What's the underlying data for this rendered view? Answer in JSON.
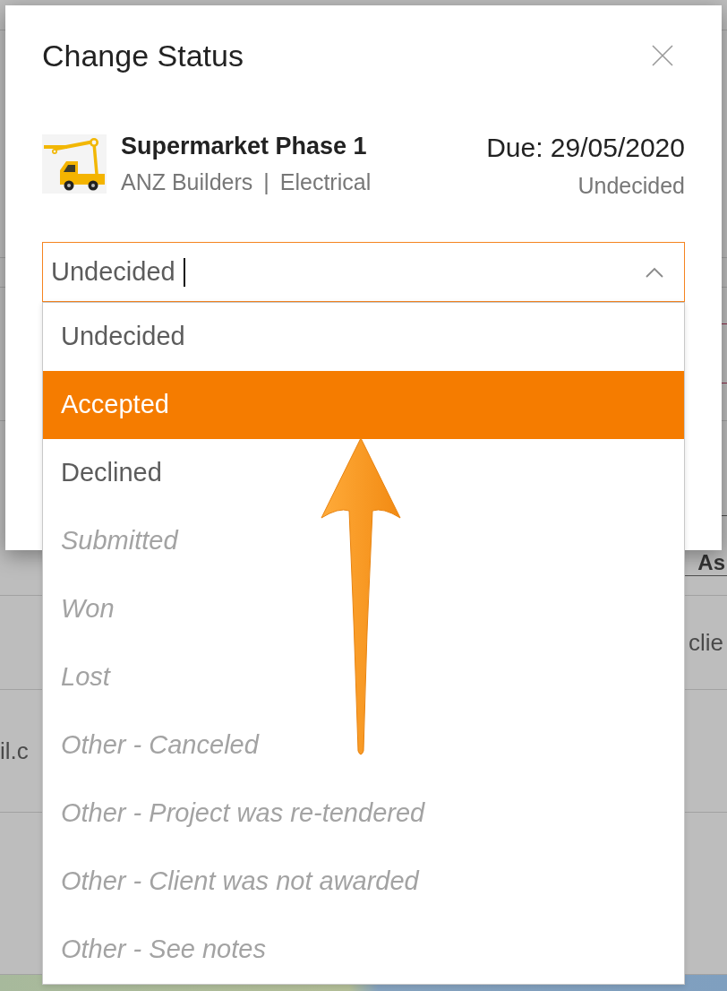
{
  "background": {
    "column_heading": "As",
    "cell_right": "clie",
    "cell_left": "il.c"
  },
  "modal": {
    "title": "Change Status",
    "project": {
      "name": "Supermarket Phase 1",
      "client": "ANZ Builders",
      "separator": "|",
      "trade": "Electrical",
      "due": "Due: 29/05/2020",
      "status": "Undecided"
    },
    "status_select": {
      "value": "Undecided",
      "focused": true,
      "expanded": true,
      "options": [
        {
          "label": "Undecided",
          "highlighted": false,
          "disabled": false
        },
        {
          "label": "Accepted",
          "highlighted": true,
          "disabled": false
        },
        {
          "label": "Declined",
          "highlighted": false,
          "disabled": false
        },
        {
          "label": "Submitted",
          "highlighted": false,
          "disabled": true
        },
        {
          "label": "Won",
          "highlighted": false,
          "disabled": true
        },
        {
          "label": "Lost",
          "highlighted": false,
          "disabled": true
        },
        {
          "label": "Other - Canceled",
          "highlighted": false,
          "disabled": true
        },
        {
          "label": "Other - Project was re-tendered",
          "highlighted": false,
          "disabled": true
        },
        {
          "label": "Other - Client was not awarded",
          "highlighted": false,
          "disabled": true
        },
        {
          "label": "Other - See notes",
          "highlighted": false,
          "disabled": true
        }
      ]
    }
  }
}
